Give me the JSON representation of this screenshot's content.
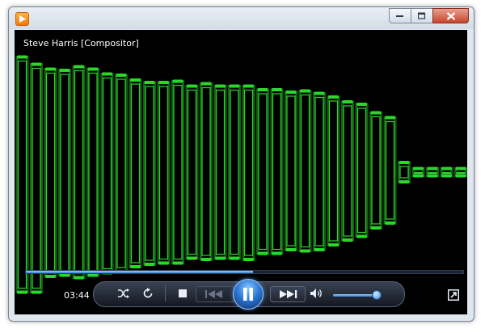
{
  "window": {
    "app_icon": "media-player-icon",
    "controls": [
      "minimize-icon",
      "maximize-icon",
      "close-icon"
    ]
  },
  "now_playing": {
    "title": "Steve Harris [Compositor]"
  },
  "visualizer": {
    "style": "green-bars",
    "color": "#2ad82a",
    "glow": "#145c14",
    "bars": [
      {
        "top": 0.95,
        "bottom": 0.99
      },
      {
        "top": 0.89,
        "bottom": 0.99
      },
      {
        "top": 0.85,
        "bottom": 0.86
      },
      {
        "top": 0.84,
        "bottom": 0.85
      },
      {
        "top": 0.87,
        "bottom": 0.87
      },
      {
        "top": 0.85,
        "bottom": 0.85
      },
      {
        "top": 0.81,
        "bottom": 0.83
      },
      {
        "top": 0.8,
        "bottom": 0.82
      },
      {
        "top": 0.76,
        "bottom": 0.78
      },
      {
        "top": 0.74,
        "bottom": 0.76
      },
      {
        "top": 0.74,
        "bottom": 0.75
      },
      {
        "top": 0.75,
        "bottom": 0.75
      },
      {
        "top": 0.71,
        "bottom": 0.71
      },
      {
        "top": 0.73,
        "bottom": 0.72
      },
      {
        "top": 0.71,
        "bottom": 0.71
      },
      {
        "top": 0.71,
        "bottom": 0.71
      },
      {
        "top": 0.71,
        "bottom": 0.72
      },
      {
        "top": 0.68,
        "bottom": 0.67
      },
      {
        "top": 0.68,
        "bottom": 0.67
      },
      {
        "top": 0.66,
        "bottom": 0.64
      },
      {
        "top": 0.67,
        "bottom": 0.65
      },
      {
        "top": 0.65,
        "bottom": 0.64
      },
      {
        "top": 0.62,
        "bottom": 0.6
      },
      {
        "top": 0.58,
        "bottom": 0.56
      },
      {
        "top": 0.56,
        "bottom": 0.53
      },
      {
        "top": 0.49,
        "bottom": 0.46
      },
      {
        "top": 0.45,
        "bottom": 0.42
      },
      {
        "top": 0.08,
        "bottom": 0.08
      },
      {
        "top": 0.03,
        "bottom": 0.03
      },
      {
        "top": 0.03,
        "bottom": 0.03
      },
      {
        "top": 0.03,
        "bottom": 0.03
      },
      {
        "top": 0.03,
        "bottom": 0.03
      }
    ]
  },
  "seek": {
    "progress": 0.52,
    "color": "#2a7fd8"
  },
  "controls": {
    "elapsed": "03:44",
    "shuffle_icon": "shuffle-icon",
    "repeat_icon": "repeat-icon",
    "stop_icon": "stop-icon",
    "previous_icon": "previous-icon",
    "play_pause_icon": "pause-icon",
    "next_icon": "next-icon",
    "volume_icon": "speaker-icon",
    "volume_level": 0.92,
    "switch_icon": "switch-to-library-icon"
  }
}
